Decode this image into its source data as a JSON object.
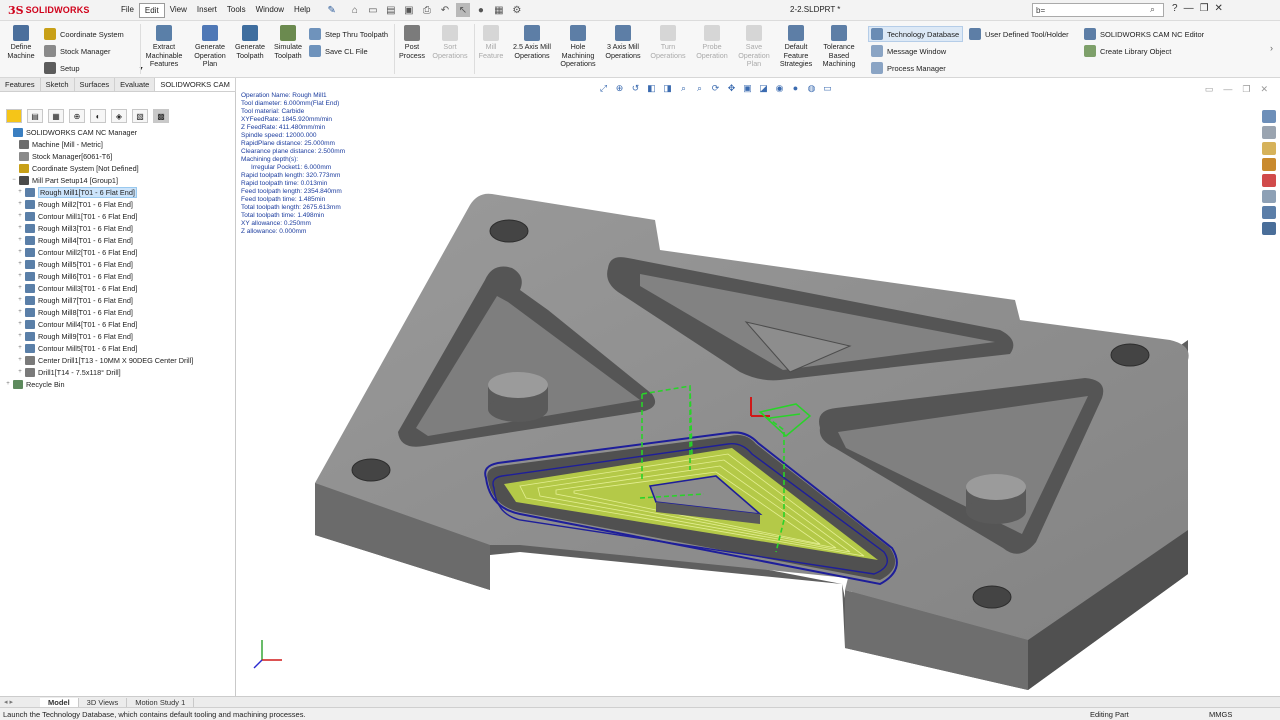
{
  "app": {
    "logo_text": "SOLIDWORKS",
    "document_title": "2-2.SLDPRT *"
  },
  "menu": [
    "File",
    "Edit",
    "View",
    "Insert",
    "Tools",
    "Window",
    "Help"
  ],
  "menu_active": "Edit",
  "search": {
    "value": "b="
  },
  "ribbon": {
    "small_left": [
      "Coordinate System",
      "Stock Manager",
      "Setup"
    ],
    "define_machine": "Define Machine",
    "extract": "Extract Machinable Features",
    "gen_plan": "Generate Operation Plan",
    "gen_toolpath": "Generate Toolpath",
    "simulate": "Simulate Toolpath",
    "step_thru": "Step Thru Toolpath",
    "save_cl": "Save CL File",
    "post": "Post Process",
    "sort": "Sort Operations",
    "mill_feature": "Mill Feature",
    "axis25": "2.5 Axis Mill Operations",
    "hole": "Hole Machining Operations",
    "axis3": "3 Axis Mill Operations",
    "turn": "Turn Operations",
    "probe": "Probe Operation",
    "save_plan": "Save Operation Plan",
    "default_feature": "Default Feature Strategies",
    "tolerance": "Tolerance Based Machining",
    "tech_db": "Technology Database",
    "message_window": "Message Window",
    "process_manager": "Process Manager",
    "user_tool": "User Defined Tool/Holder",
    "nc_editor": "SOLIDWORKS CAM NC Editor",
    "library": "Create Library Object"
  },
  "panel_tabs": [
    "Features",
    "Sketch",
    "Surfaces",
    "Evaluate",
    "SOLIDWORKS CAM"
  ],
  "panel_tab_active": "SOLIDWORKS CAM",
  "tree": [
    {
      "label": "SOLIDWORKS CAM NC Manager",
      "level": 0,
      "color": "#3a7fc1"
    },
    {
      "label": "Machine [Mill - Metric]",
      "level": 1,
      "color": "#6d6d6d"
    },
    {
      "label": "Stock Manager[6061-T6]",
      "level": 1,
      "color": "#8a8a8a"
    },
    {
      "label": "Coordinate System [Not Defined]",
      "level": 1,
      "color": "#c8a017"
    },
    {
      "label": "Mill Part Setup14 [Group1]",
      "level": 1,
      "color": "#4a4a4a",
      "expander": "−"
    },
    {
      "label": "Rough Mill1[T01 - 6 Flat End]",
      "level": 2,
      "color": "#5a7fa8",
      "expander": "+",
      "selected": true
    },
    {
      "label": "Rough Mill2[T01 - 6 Flat End]",
      "level": 2,
      "color": "#5a7fa8",
      "expander": "+"
    },
    {
      "label": "Contour Mill1[T01 - 6 Flat End]",
      "level": 2,
      "color": "#5a7fa8",
      "expander": "+"
    },
    {
      "label": "Rough Mill3[T01 - 6 Flat End]",
      "level": 2,
      "color": "#5a7fa8",
      "expander": "+"
    },
    {
      "label": "Rough Mill4[T01 - 6 Flat End]",
      "level": 2,
      "color": "#5a7fa8",
      "expander": "+"
    },
    {
      "label": "Contour Mill2[T01 - 6 Flat End]",
      "level": 2,
      "color": "#5a7fa8",
      "expander": "+"
    },
    {
      "label": "Rough Mill5[T01 - 6 Flat End]",
      "level": 2,
      "color": "#5a7fa8",
      "expander": "+"
    },
    {
      "label": "Rough Mill6[T01 - 6 Flat End]",
      "level": 2,
      "color": "#5a7fa8",
      "expander": "+"
    },
    {
      "label": "Contour Mill3[T01 - 6 Flat End]",
      "level": 2,
      "color": "#5a7fa8",
      "expander": "+"
    },
    {
      "label": "Rough Mill7[T01 - 6 Flat End]",
      "level": 2,
      "color": "#5a7fa8",
      "expander": "+"
    },
    {
      "label": "Rough Mill8[T01 - 6 Flat End]",
      "level": 2,
      "color": "#5a7fa8",
      "expander": "+"
    },
    {
      "label": "Contour Mill4[T01 - 6 Flat End]",
      "level": 2,
      "color": "#5a7fa8",
      "expander": "+"
    },
    {
      "label": "Rough Mill9[T01 - 6 Flat End]",
      "level": 2,
      "color": "#5a7fa8",
      "expander": "+"
    },
    {
      "label": "Contour Mill5[T01 - 6 Flat End]",
      "level": 2,
      "color": "#5a7fa8",
      "expander": "+"
    },
    {
      "label": "Center Drill1[T13 - 10MM X 90DEG Center Drill]",
      "level": 2,
      "color": "#7a7a7a",
      "expander": "+"
    },
    {
      "label": "Drill1[T14 - 7.5x118° Drill]",
      "level": 2,
      "color": "#7a7a7a",
      "expander": "+"
    },
    {
      "label": "Recycle Bin",
      "level": 0,
      "color": "#5d8a5d",
      "expander": "+"
    }
  ],
  "operation_info": [
    "Operation Name: Rough Mill1",
    "Tool diameter: 6.000mm(Flat End)",
    "Tool material: Carbide",
    "XYFeedRate: 1845.920mm/min",
    "Z FeedRate: 411.480mm/min",
    "Spindle speed: 12000.000",
    "RapidPlane distance: 25.000mm",
    "Clearance plane distance: 2.500mm",
    "Machining depth(s):",
    "  Irregular Pocket1: 6.000mm",
    "Rapid toolpath length: 320.773mm",
    "Rapid toolpath time: 0.013min",
    "Feed toolpath length: 2354.840mm",
    "Feed toolpath time: 1.485min",
    "Total toolpath length: 2675.613mm",
    "Total toolpath time: 1.498min",
    "XY allowance: 0.250mm",
    "Z allowance: 0.000mm"
  ],
  "bottom_tabs": [
    "Model",
    "3D Views",
    "Motion Study 1"
  ],
  "bottom_tab_active": "Model",
  "status": {
    "message": "Launch the Technology Database, which contains default tooling and machining processes.",
    "mode": "Editing Part",
    "units": "MMGS"
  },
  "colors": {
    "brand": "#d0021b",
    "part_top": "#8e8e8e",
    "part_side": "#5f5f5f",
    "pocket_floor": "#7c7c7c",
    "toolpath_outline": "#1e1e9a",
    "toolpath_fill": "#c6de46",
    "rapid_path": "#29d329",
    "info_text": "#1b3c9e"
  }
}
